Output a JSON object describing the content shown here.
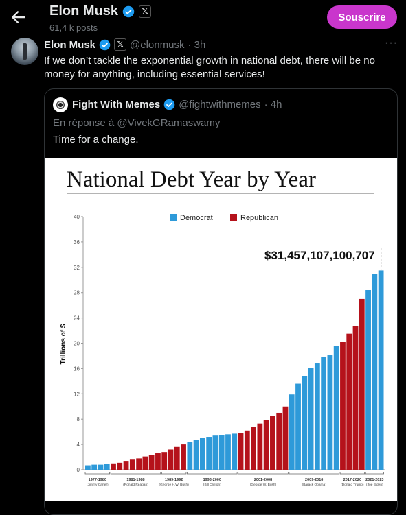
{
  "header": {
    "name": "Elon Musk",
    "posts": "61,4 k posts",
    "subscribe_label": "Souscrire"
  },
  "tweet": {
    "name": "Elon Musk",
    "handle": "@elonmusk",
    "time": "· 3h",
    "text": "If we don’t tackle the exponential growth in national debt, there will be no money for anything, including essential services!"
  },
  "quote": {
    "name": "Fight With Memes",
    "handle": "@fightwithmemes",
    "time": "· 4h",
    "reply": "En réponse à @VivekGRamaswamy",
    "text": "Time for a change."
  },
  "colors": {
    "accent": "#c936cc",
    "verified": "#1d9bf0",
    "democrat": "#2e9ad9",
    "republican": "#b5121b"
  },
  "chart_data": {
    "type": "bar",
    "title": "National Debt Year by Year",
    "ylabel": "Trillions of $",
    "ylim": [
      0,
      40
    ],
    "yticks": [
      "0",
      "4",
      "8",
      "12",
      "16",
      "20",
      "24",
      "28",
      "32",
      "36",
      "40"
    ],
    "annotation": "$31,457,107,100,707",
    "legend": [
      {
        "name": "Democrat",
        "color": "#2e9ad9"
      },
      {
        "name": "Republican",
        "color": "#b5121b"
      }
    ],
    "values": [
      0.7,
      0.8,
      0.8,
      0.9,
      1.0,
      1.1,
      1.4,
      1.6,
      1.8,
      2.1,
      2.3,
      2.6,
      2.8,
      3.2,
      3.6,
      4.0,
      4.4,
      4.7,
      5.0,
      5.2,
      5.4,
      5.5,
      5.6,
      5.7,
      5.8,
      6.2,
      6.8,
      7.3,
      7.9,
      8.5,
      9.0,
      10.0,
      11.9,
      13.6,
      14.8,
      16.1,
      16.8,
      17.8,
      18.1,
      19.6,
      20.2,
      21.5,
      22.7,
      27.0,
      28.4,
      30.9,
      31.5
    ],
    "parties": [
      "D",
      "D",
      "D",
      "D",
      "R",
      "R",
      "R",
      "R",
      "R",
      "R",
      "R",
      "R",
      "R",
      "R",
      "R",
      "R",
      "D",
      "D",
      "D",
      "D",
      "D",
      "D",
      "D",
      "D",
      "R",
      "R",
      "R",
      "R",
      "R",
      "R",
      "R",
      "R",
      "D",
      "D",
      "D",
      "D",
      "D",
      "D",
      "D",
      "D",
      "R",
      "R",
      "R",
      "R",
      "D",
      "D",
      "D"
    ],
    "groups": [
      {
        "label": "1977-1980",
        "sub": "(Jimmy Carter)",
        "start": 0,
        "end": 3
      },
      {
        "label": "1981-1988",
        "sub": "(Ronald Reagan)",
        "start": 4,
        "end": 11
      },
      {
        "label": "1989-1992",
        "sub": "(George H.W. Bush)",
        "start": 12,
        "end": 15
      },
      {
        "label": "1993-2000",
        "sub": "(Bill Clinton)",
        "start": 16,
        "end": 23
      },
      {
        "label": "2001-2008",
        "sub": "(George W. Bush)",
        "start": 24,
        "end": 31
      },
      {
        "label": "2009-2016",
        "sub": "(Barack Obama)",
        "start": 32,
        "end": 39
      },
      {
        "label": "2017-2020",
        "sub": "(Donald Trump)",
        "start": 40,
        "end": 43
      },
      {
        "label": "2021-2023",
        "sub": "(Joe Biden)",
        "start": 44,
        "end": 46
      }
    ]
  }
}
